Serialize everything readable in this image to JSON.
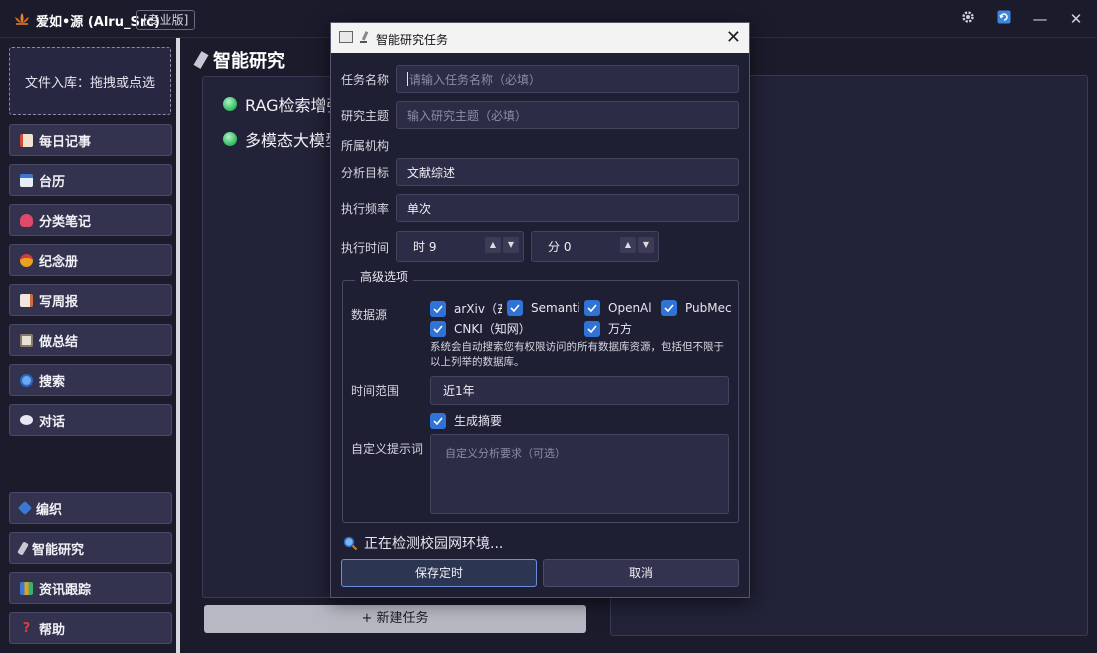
{
  "app": {
    "title": "爱如•源 (Alru_Src)",
    "edition": "[专业版]",
    "accent_color": "#2f73d6",
    "logo_icon": "lotus-icon",
    "top_icons": [
      "gear-icon",
      "refresh-icon",
      "minimize-icon",
      "close-icon"
    ],
    "minimize_glyph": "—",
    "close_glyph": "✕"
  },
  "sidebar": {
    "dropzone_label": "文件入库：拖拽或点选",
    "items": [
      {
        "label": "每日记事",
        "icon": "diary-icon"
      },
      {
        "label": "台历",
        "icon": "calendar-icon"
      },
      {
        "label": "分类笔记",
        "icon": "category-notes-icon"
      },
      {
        "label": "纪念册",
        "icon": "medal-icon"
      },
      {
        "label": "写周报",
        "icon": "report-icon"
      },
      {
        "label": "做总结",
        "icon": "summary-icon"
      },
      {
        "label": "搜索",
        "icon": "search-icon"
      },
      {
        "label": "对话",
        "icon": "chat-icon"
      },
      {
        "label": "编织",
        "icon": "weave-icon"
      },
      {
        "label": "智能研究",
        "icon": "research-icon"
      },
      {
        "label": "资讯跟踪",
        "icon": "news-icon"
      },
      {
        "label": "帮助",
        "icon": "help-icon"
      }
    ]
  },
  "main": {
    "page_title": "智能研究",
    "tasks": [
      {
        "label": "RAG检索增强"
      },
      {
        "label": "多模态大模型"
      }
    ],
    "new_task_label": "+ 新建任务"
  },
  "dialog": {
    "title": "智能研究任务",
    "close_glyph": "✕",
    "fields": {
      "task_name_label": "任务名称",
      "task_name_placeholder": "请输入任务名称（必填）",
      "topic_label": "研究主题",
      "topic_placeholder": "输入研究主题（必填）",
      "org_label": "所属机构",
      "goal_label": "分析目标",
      "goal_value": "文献综述",
      "freq_label": "执行频率",
      "freq_value": "单次",
      "time_label": "执行时间",
      "hour_value": "时 9",
      "minute_value": "分 0",
      "spin_up": "▲",
      "spin_down": "▼"
    },
    "advanced": {
      "title": "高级选项",
      "sources_label": "数据源",
      "sources": [
        {
          "label": "arXiv（∄",
          "checked": true
        },
        {
          "label": "Semanti",
          "checked": true
        },
        {
          "label": "OpenAl",
          "checked": true
        },
        {
          "label": "PubMec",
          "checked": true
        },
        {
          "label": "CNKI（知网）",
          "checked": true
        },
        {
          "label": "万方",
          "checked": true
        }
      ],
      "hint": "系统会自动搜索您有权限访问的所有数据库资源，包括但不限于以上列举的数据库。",
      "range_label": "时间范围",
      "range_value": "近1年",
      "summary_label": "生成摘要",
      "summary_checked": true,
      "prompt_label": "自定义提示词",
      "prompt_placeholder": "自定义分析要求（可选）"
    },
    "status": "正在检测校园网环境...",
    "save_label": "保存定时",
    "cancel_label": "取消"
  }
}
